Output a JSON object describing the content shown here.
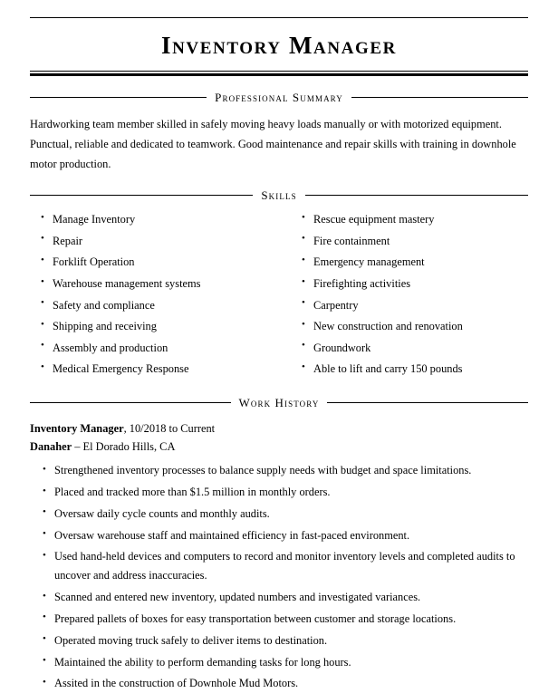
{
  "document": {
    "title": "Inventory Manager"
  },
  "sections": {
    "summary": {
      "heading": "Professional Summary",
      "text": "Hardworking team member skilled in safely moving heavy loads manually or with motorized equipment. Punctual, reliable and dedicated to teamwork. Good maintenance and repair skills with training in downhole motor production."
    },
    "skills": {
      "heading": "Skills",
      "left_column": [
        "Manage Inventory",
        "Repair",
        "Forklift Operation",
        "Warehouse management systems",
        "Safety and compliance",
        "Shipping and receiving",
        "Assembly and production",
        "Medical Emergency Response"
      ],
      "right_column": [
        "Rescue equipment mastery",
        "Fire containment",
        "Emergency management",
        "Firefighting activities",
        "Carpentry",
        "New construction and renovation",
        "Groundwork",
        "Able to lift and carry 150 pounds"
      ]
    },
    "work_history": {
      "heading": "Work History",
      "jobs": [
        {
          "job_title": "Inventory Manager",
          "title_separator": ", ",
          "dates": "10/2018 to Current",
          "company": "Danaher",
          "company_separator": " – ",
          "location": "El Dorado Hills, CA",
          "bullets": [
            "Strengthened inventory processes to balance supply needs with budget and space limitations.",
            "Placed and tracked more than $1.5 million in monthly orders.",
            "Oversaw daily cycle counts and monthly audits.",
            "Oversaw warehouse staff and maintained efficiency in fast-paced environment.",
            "Used hand-held devices and computers to record and monitor inventory levels and completed audits to uncover and address inaccuracies.",
            "Scanned and entered new inventory, updated numbers and investigated variances.",
            "Prepared pallets of boxes for easy transportation between customer and storage locations.",
            "Operated moving truck safely to deliver items to destination.",
            "Maintained the ability to perform demanding tasks for long hours.",
            "Assited in the construction of Downhole Mud Motors."
          ]
        }
      ]
    }
  }
}
